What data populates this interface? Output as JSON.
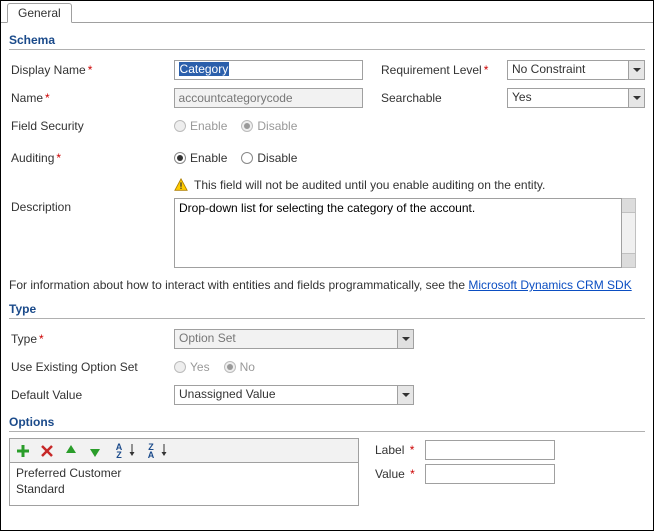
{
  "tab": {
    "general": "General"
  },
  "sections": {
    "schema": "Schema",
    "type": "Type",
    "options": "Options"
  },
  "schema": {
    "displayName": {
      "label": "Display Name",
      "value": "Category"
    },
    "name": {
      "label": "Name",
      "value": "accountcategorycode"
    },
    "fieldSecurity": {
      "label": "Field Security",
      "enable": "Enable",
      "disable": "Disable"
    },
    "auditing": {
      "label": "Auditing",
      "enable": "Enable",
      "disable": "Disable",
      "selected": "enable"
    },
    "auditingWarning": "This field will not be audited until you enable auditing on the entity.",
    "description": {
      "label": "Description",
      "value": "Drop-down list for selecting the category of the account."
    },
    "requirementLevel": {
      "label": "Requirement Level",
      "value": "No Constraint"
    },
    "searchable": {
      "label": "Searchable",
      "value": "Yes"
    }
  },
  "info": {
    "prefix": "For information about how to interact with entities and fields programmatically, see the ",
    "linkText": "Microsoft Dynamics CRM SDK"
  },
  "type": {
    "type": {
      "label": "Type",
      "value": "Option Set"
    },
    "useExisting": {
      "label": "Use Existing Option Set",
      "yes": "Yes",
      "no": "No",
      "selected": "no"
    },
    "defaultValue": {
      "label": "Default Value",
      "value": "Unassigned Value"
    }
  },
  "options": {
    "items": [
      "Preferred Customer",
      "Standard"
    ],
    "label": {
      "label": "Label",
      "value": ""
    },
    "value": {
      "label": "Value",
      "value": ""
    }
  }
}
